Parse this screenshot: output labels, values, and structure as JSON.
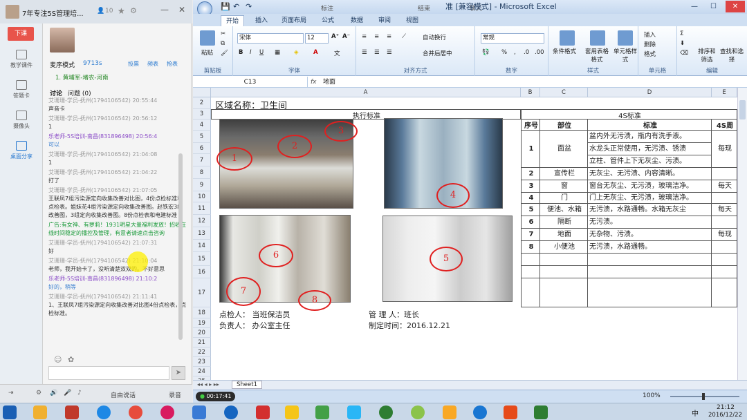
{
  "left_panel": {
    "window_title": "7年专注5S管理培...",
    "viewer_count": "10",
    "end_class_label": "下课",
    "rail": [
      {
        "label": "教学课件",
        "icon": "slides-icon"
      },
      {
        "label": "答题卡",
        "icon": "answer-card-icon"
      },
      {
        "label": "摄像头",
        "icon": "camera-icon"
      },
      {
        "label": "桌面分享",
        "icon": "desktop-share-icon"
      }
    ],
    "host_name": "麦序模式",
    "host_score": "9713s",
    "host_links": [
      "投票",
      "频表",
      "抢表"
    ],
    "mic_user": "1. 黄埔军-堵农-河南",
    "tabs": [
      "讨论",
      "问题 (0)"
    ],
    "messages": [
      {
        "who": "艾珊珊-学员-抚州(1794106542) 20:55:44",
        "text": "声音卡",
        "teacher": false
      },
      {
        "who": "艾珊珊-学员-抚州(1794106542) 20:56:12",
        "text": "1",
        "teacher": false
      },
      {
        "who": "乐老师-5S培训-南昌(831896498) 20:56:4",
        "text": "可以",
        "teacher": true
      },
      {
        "who": "艾珊珊-学员-抚州(1794106542) 21:04:08",
        "text": "1",
        "teacher": false
      },
      {
        "who": "艾珊珊-学员-抚州(1794106542) 21:04:22",
        "text": "打了",
        "teacher": false
      },
      {
        "who": "艾珊珊-学员-抚州(1794106542) 21:07:05",
        "text": "王联凤7组污染源定向收集改善对比图，4份点检标准和点检表。姐妹花4组污染源定向收集改善图。赵铁宏3组改善图，3组定向收集改善图。8份点检表和电建标准",
        "teacher": false
      },
      {
        "who": "",
        "text": "广告:有女神、有萝莉！1931明星大量福利发放！招收在线时间稳定的播控及管理，有意者请速点击咨询",
        "teacher": false,
        "ad": true
      },
      {
        "who": "艾珊珊-学员-抚州(1794106542) 21:07:31",
        "text": "好",
        "teacher": false
      },
      {
        "who": "艾珊珊-学员-抚州(1794106542) 21:10:04",
        "text": "老师，我开始卡了，没听清楚双双的。不好意思",
        "teacher": false
      },
      {
        "who": "乐老师-5S培训-南昌(831896498) 21:10:2",
        "text": "好的，稍等",
        "teacher": true
      },
      {
        "who": "艾珊珊-学员-抚州(1794106542) 21:11:41",
        "text": "1、王联凤7组污染源定向收集改善对比图4份点检表，点检标准。",
        "teacher": false
      }
    ],
    "bottom_label": "自由说话",
    "record_label": "录音"
  },
  "excel": {
    "title": "准 [兼容模式] - Microsoft Excel",
    "qa_items": [
      "标注",
      "结束",
      "聊天"
    ],
    "tabs": [
      "开始",
      "插入",
      "页面布局",
      "公式",
      "数据",
      "审阅",
      "视图"
    ],
    "active_tab": "开始",
    "groups": {
      "clipboard": {
        "label": "剪贴板",
        "paste": "粘贴"
      },
      "font": {
        "label": "字体",
        "name": "宋体",
        "size": "12"
      },
      "alignment": {
        "label": "对齐方式",
        "wrap": "自动换行",
        "merge": "合并后居中"
      },
      "number": {
        "label": "数字",
        "format": "常规"
      },
      "styles": {
        "label": "样式",
        "cond": "条件格式",
        "table": "套用表格格式",
        "cell": "单元格样式"
      },
      "cells": {
        "label": "单元格",
        "insert": "插入",
        "delete": "删除",
        "format": "格式"
      },
      "editing": {
        "label": "编辑",
        "sort": "排序和筛选",
        "find": "查找和选择"
      }
    },
    "name_box": "C13",
    "formula": "地面",
    "columns": [
      "A",
      "B",
      "C",
      "D",
      "E"
    ],
    "rows": [
      "2",
      "3",
      "4",
      "5",
      "6",
      "7",
      "8",
      "9",
      "10",
      "11",
      "12",
      "13",
      "14",
      "15",
      "16",
      "17",
      "18",
      "19",
      "20",
      "21",
      "22",
      "23",
      "24",
      "25"
    ],
    "area_title": "区域名称：卫生间",
    "exec_std_header": "执行标准",
    "std_4s_header": "4S标准",
    "table_headers": [
      "序号",
      "部位",
      "标准",
      "4S周"
    ],
    "table_rows": [
      {
        "no": "1",
        "part": "面盆",
        "std": [
          "盆内外无污渍，瓶内有洗手液。",
          "水龙头正常使用，无污渍、锈渍",
          "立柱、管件上下无灰尘、污渍。"
        ],
        "freq": "每现"
      },
      {
        "no": "2",
        "part": "宣传栏",
        "std": [
          "无灰尘、无污渍、内容清晰。"
        ],
        "freq": ""
      },
      {
        "no": "3",
        "part": "窗",
        "std": [
          "窗台无灰尘、无污渍，玻璃洁净。"
        ],
        "freq": "每天"
      },
      {
        "no": "4",
        "part": "门",
        "std": [
          "门上无灰尘、无污渍，玻璃洁净。"
        ],
        "freq": ""
      },
      {
        "no": "5",
        "part": "便池、水箱",
        "std": [
          "无污渍，水路通畅。水箱无灰尘"
        ],
        "freq": "每天"
      },
      {
        "no": "6",
        "part": "隔断",
        "std": [
          "无污渍。"
        ],
        "freq": ""
      },
      {
        "no": "7",
        "part": "地面",
        "std": [
          "无杂物、污渍。"
        ],
        "freq": "每现"
      },
      {
        "no": "8",
        "part": "小便池",
        "std": [
          "无污渍，水路通畅。"
        ],
        "freq": ""
      }
    ],
    "circle_labels": [
      "1",
      "2",
      "3",
      "4",
      "5",
      "6",
      "7",
      "8"
    ],
    "footer": {
      "inspector": "点检人：  当班保洁员",
      "manager": "管  理  人：班长",
      "owner": "负责人：  办公室主任",
      "date": "制定时间：2016.12.21"
    },
    "sheet_tab": "Sheet1",
    "timer": "00:17:41",
    "zoom": "100%"
  },
  "taskbar": {
    "time": "21:12",
    "date": "2016/12/22",
    "ime": "中"
  }
}
